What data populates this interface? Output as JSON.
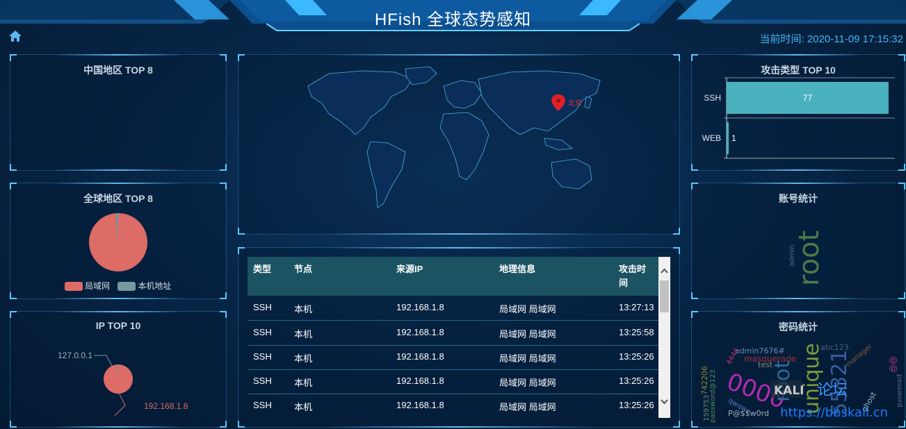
{
  "header": {
    "title": "HFish 全球态势感知",
    "clock": "当前时间: 2020-11-09 17:15:32"
  },
  "panels": {
    "china_top": {
      "title": "中国地区 TOP 8"
    },
    "global_top": {
      "title": "全球地区 TOP 8",
      "legend": [
        {
          "label": "局域网",
          "color": "#dd6b66"
        },
        {
          "label": "本机地址",
          "color": "#759aa0"
        }
      ]
    },
    "ip_top": {
      "title": "IP TOP 10",
      "labels": [
        "127.0.0.1",
        "192.168.1.8"
      ]
    },
    "attack_type": {
      "title": "攻击类型 TOP 10"
    },
    "account": {
      "title": "账号统计",
      "words": [
        "root",
        "admin"
      ]
    },
    "password": {
      "title": "密码统计",
      "words": [
        "admin7676#",
        "abc123.",
        "masquerade",
        "4444",
        "742206",
        "test",
        "password@123",
        "0000",
        "root",
        "unique",
        "55321",
        "KALI",
        "论坛",
        "159753",
        "qwqwe",
        "P@$$w0rd",
        "ghost",
        "@@",
        "password",
        "manager"
      ]
    }
  },
  "map": {
    "marker_label": "北京"
  },
  "table": {
    "headers": [
      "类型",
      "节点",
      "来源IP",
      "地理信息",
      "攻击时间"
    ],
    "rows": [
      [
        "SSH",
        "本机",
        "192.168.1.8",
        "局域网 局域网",
        "13:27:13"
      ],
      [
        "SSH",
        "本机",
        "192.168.1.8",
        "局域网 局域网",
        "13:25:58"
      ],
      [
        "SSH",
        "本机",
        "192.168.1.8",
        "局域网 局域网",
        "13:25:26"
      ],
      [
        "SSH",
        "本机",
        "192.168.1.8",
        "局域网 局域网",
        "13:25:26"
      ],
      [
        "SSH",
        "本机",
        "192.168.1.8",
        "局域网 局域网",
        "13:25:26"
      ]
    ]
  },
  "chart_data": [
    {
      "type": "pie",
      "title": "全球地区 TOP 8",
      "categories": [
        "局域网",
        "本机地址"
      ],
      "values": [
        77,
        1
      ]
    },
    {
      "type": "pie",
      "title": "IP TOP 10",
      "categories": [
        "192.168.1.8",
        "127.0.0.1"
      ],
      "values": [
        77,
        1
      ]
    },
    {
      "type": "bar",
      "title": "攻击类型 TOP 10",
      "orientation": "horizontal",
      "categories": [
        "SSH",
        "WEB"
      ],
      "values": [
        77,
        1
      ],
      "xlim": [
        0,
        80
      ]
    }
  ],
  "watermark": "https://bbskali.cn",
  "colors": {
    "accent": "#41b6f0",
    "bar": "#4bb1be",
    "pie_main": "#dd6b66",
    "pie_minor": "#759aa0",
    "table_header": "#1b5363"
  }
}
